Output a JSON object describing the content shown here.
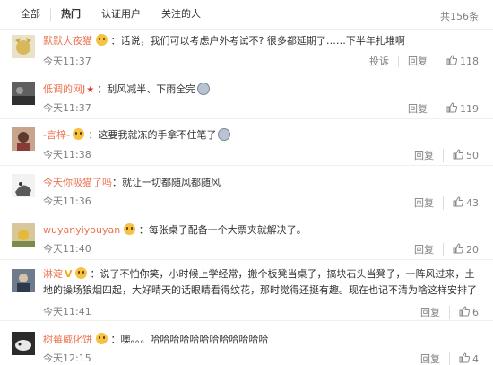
{
  "tabs": [
    {
      "label": "全部",
      "active": false
    },
    {
      "label": "热门",
      "active": true
    },
    {
      "label": "认证用户",
      "active": false
    },
    {
      "label": "关注的人",
      "active": false
    }
  ],
  "total": "共156条",
  "comments": [
    {
      "user": "默默大夜猫",
      "sep": "：",
      "text": "话说，我们可以考虑户外考试不? 很多都延期了……下半年扎堆啊",
      "time": "今天11:37",
      "report": "投诉",
      "reply": "回复",
      "likes": "118"
    },
    {
      "user": "低调的网J",
      "sep": "：",
      "text": "刮风减半、下雨全完",
      "time": "今天11:37",
      "reply": "回复",
      "likes": "119"
    },
    {
      "user": "-言梓-",
      "sep": "：",
      "text": "这要我就冻的手拿不住笔了",
      "time": "今天11:38",
      "reply": "回复",
      "likes": "50"
    },
    {
      "user": "今天你吸猫了吗",
      "sep": "：",
      "text": "就让一切都随风都随风",
      "time": "今天11:36",
      "reply": "回复",
      "likes": "43"
    },
    {
      "user": "wuyanyiyouyan",
      "sep": "：",
      "text": "每张桌子配备一个大票夹就解决了。",
      "time": "今天11:40",
      "reply": "回复",
      "likes": "20"
    },
    {
      "user": "淋淀",
      "sep": "：",
      "text": "说了不怕你笑，小时候上学经常，搬个板凳当桌子，搞块石头当凳子，一阵风过来，土地的操场狼烟四起，大好晴天的话眼睛看得纹花，那时觉得还挺有趣。现在也记不清为啥这样安排了",
      "time": "今天11:41",
      "reply": "回复",
      "likes": "6"
    },
    {
      "user": "树莓威化饼",
      "sep": "：",
      "text": "噢。。。哈哈哈哈哈哈哈哈哈哈哈哈",
      "time": "今天12:15",
      "reply": "回复",
      "likes": "4"
    }
  ]
}
